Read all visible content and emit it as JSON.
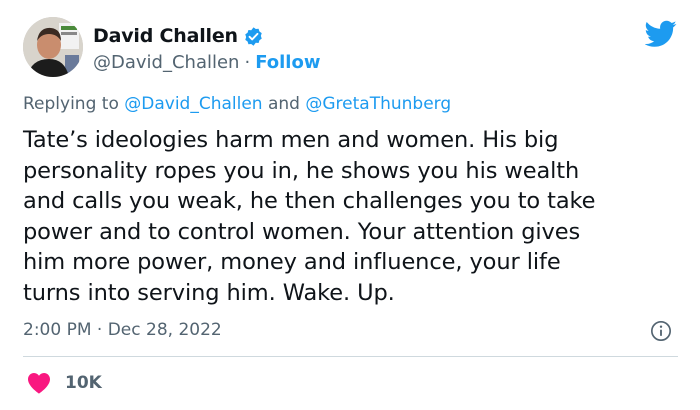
{
  "author": {
    "display_name": "David Challen",
    "handle": "@David_Challen",
    "separator": "·",
    "follow_label": "Follow",
    "verified": true
  },
  "reply": {
    "prefix": "Replying to",
    "mention_1": "@David_Challen",
    "conjunction": "and",
    "mention_2": "@GretaThunberg"
  },
  "tweet": {
    "text": "Tate’s ideologies harm men and women. His big\npersonality ropes you in, he shows you his wealth\nand calls you weak, he then challenges you to take\npower and to control women. Your attention gives\nhim more power, money and influence, your life\nturns into serving him. Wake. Up.",
    "time": "2:00 PM",
    "date_separator": "·",
    "date": "Dec 28, 2022"
  },
  "engagement": {
    "likes": "10K"
  },
  "icons": {
    "brand": "twitter-bird-icon",
    "verified": "verified-badge-icon",
    "info": "info-icon",
    "like": "heart-icon"
  },
  "colors": {
    "accent": "#1d9bf0",
    "secondary_text": "#536471",
    "like": "#f91880",
    "divider": "#cfd9de"
  }
}
